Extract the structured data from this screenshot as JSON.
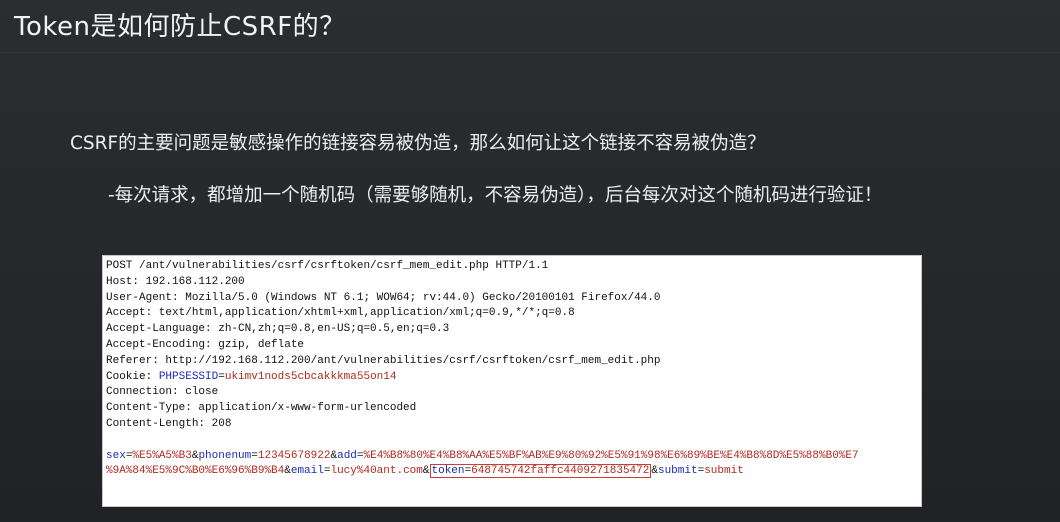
{
  "title": "Token是如何防止CSRF的？",
  "question": "CSRF的主要问题是敏感操作的链接容易被伪造，那么如何让这个链接不容易被伪造？",
  "answer": "-每次请求，都增加一个随机码（需要够随机，不容易伪造），后台每次对这个随机码进行验证！",
  "http_request": {
    "request_line": "POST /ant/vulnerabilities/csrf/csrftoken/csrf_mem_edit.php HTTP/1.1",
    "host": "Host: 192.168.112.200",
    "user_agent": "User-Agent: Mozilla/5.0 (Windows NT 6.1; WOW64; rv:44.0) Gecko/20100101 Firefox/44.0",
    "accept": "Accept: text/html,application/xhtml+xml,application/xml;q=0.9,*/*;q=0.8",
    "accept_language": "Accept-Language: zh-CN,zh;q=0.8,en-US;q=0.5,en;q=0.3",
    "accept_encoding": "Accept-Encoding: gzip, deflate",
    "referer": "Referer: http://192.168.112.200/ant/vulnerabilities/csrf/csrftoken/csrf_mem_edit.php",
    "cookie_label": "Cookie: ",
    "cookie_name": "PHPSESSID",
    "cookie_value": "ukimv1nods5cbcakkkma55on14",
    "connection": "Connection: close",
    "content_type": "Content-Type: application/x-www-form-urlencoded",
    "content_length": "Content-Length: 208",
    "body": {
      "sex_name": "sex",
      "sex_value": "%E5%A5%B3",
      "phone_name": "phonenum",
      "phone_value": "12345678922",
      "add_name": "add",
      "add_value_line1": "%E4%B8%80%E4%B8%AA%E5%BF%AB%E9%80%92%E5%91%98%E6%89%BE%E4%B8%8D%E5%88%B0%E7",
      "add_value_line2": "%9A%84%E5%9C%B0%E6%96%B9%B4",
      "email_name": "email",
      "email_value": "lucy%40ant.com",
      "token_name": "token",
      "token_value": "648745742faffc4409271835472",
      "submit_name": "submit",
      "submit_value": "submit"
    }
  },
  "colors": {
    "background": "#24262a",
    "param_name": "#1d2bb0",
    "param_value": "#b02a1d",
    "token_border": "#c2413a"
  }
}
